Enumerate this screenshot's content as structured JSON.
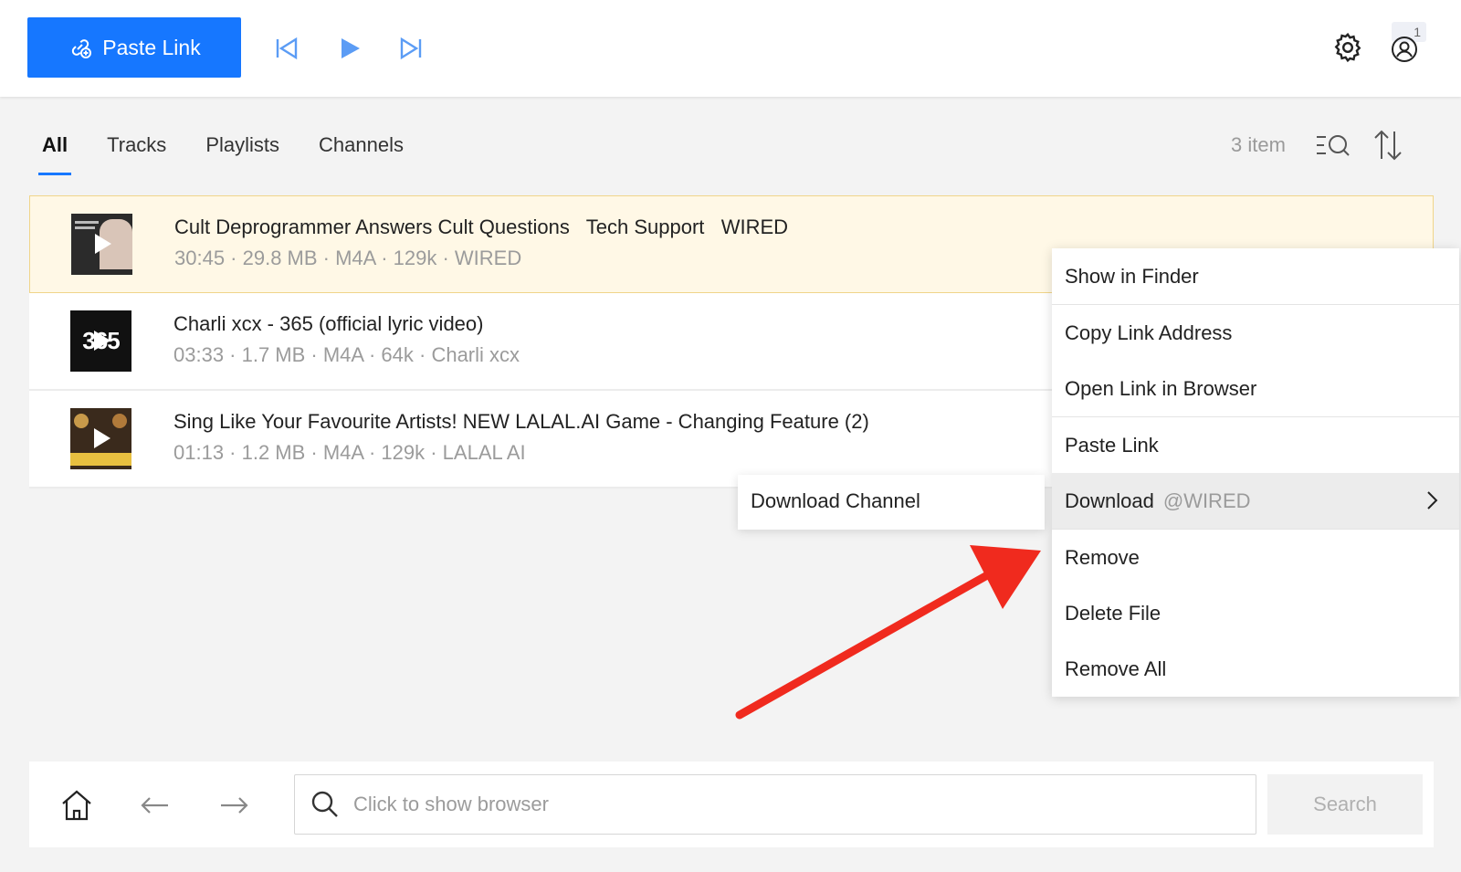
{
  "toolbar": {
    "paste_label": "Paste Link",
    "paste_icon": "link-add-icon",
    "prev_icon": "skip-back-icon",
    "play_icon": "play-icon",
    "next_icon": "skip-forward-icon",
    "settings_icon": "gear-icon",
    "user_icon": "user-icon",
    "user_badge": "1",
    "accent": "#1677ff"
  },
  "tabs": [
    {
      "label": "All",
      "active": true
    },
    {
      "label": "Tracks",
      "active": false
    },
    {
      "label": "Playlists",
      "active": false
    },
    {
      "label": "Channels",
      "active": false
    }
  ],
  "list_header": {
    "count": "3 item",
    "filter_icon": "filter-search-icon",
    "sort_icon": "sort-icon"
  },
  "items": [
    {
      "title": "Cult Deprogrammer Answers Cult Questions   Tech Support   WIRED",
      "meta": "30:45 · 29.8 MB · M4A · 129k · WIRED",
      "selected": true
    },
    {
      "title": "Charli xcx - 365 (official lyric video)",
      "meta": "03:33 · 1.7 MB · M4A · 64k · Charli xcx",
      "thumb_text": "365",
      "selected": false
    },
    {
      "title": "Sing Like Your Favourite Artists! NEW LALAL.AI Game - Changing Feature (2)",
      "meta": "01:13 · 1.2 MB · M4A · 129k · LALAL AI",
      "selected": false
    }
  ],
  "context_menu": {
    "show_in_finder": "Show in Finder",
    "copy_link": "Copy Link Address",
    "open_link": "Open Link in Browser",
    "paste_link": "Paste Link",
    "download": "Download",
    "download_channel_handle": "@WIRED",
    "remove": "Remove",
    "delete_file": "Delete File",
    "remove_all": "Remove All"
  },
  "submenu": {
    "download_channel": "Download Channel"
  },
  "annotation": {
    "arrow_color": "#f02a1e"
  },
  "bottom": {
    "home_icon": "home-icon",
    "back_icon": "arrow-left-icon",
    "forward_icon": "arrow-right-icon",
    "search_placeholder": "Click to show browser",
    "search_button": "Search"
  }
}
